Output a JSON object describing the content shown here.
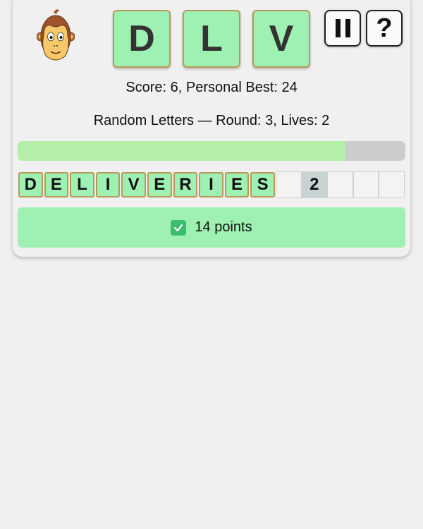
{
  "header": {
    "avatar_icon": "monkey-face-icon",
    "tiles": [
      "D",
      "L",
      "V"
    ],
    "pause_icon": "pause-icon",
    "help_label": "?"
  },
  "status": {
    "score_text": "Score: 6, Personal Best: 24",
    "round_text": "Random Letters — Round: 3, Lives: 2"
  },
  "progress": {
    "fraction": 0.845
  },
  "word": {
    "letters": [
      "D",
      "E",
      "L",
      "I",
      "V",
      "E",
      "R",
      "I",
      "E",
      "S"
    ],
    "empty_before_count": 1,
    "count": "2",
    "empty_after_count": 3
  },
  "result": {
    "icon": "check-mark-icon",
    "text": "14 points"
  },
  "colors": {
    "tile_green": "#9ff0b3",
    "tile_border": "#b89a56",
    "progress_fill": "#b3efa9",
    "progress_track": "#cccccc",
    "check_green": "#3dbd6b"
  }
}
